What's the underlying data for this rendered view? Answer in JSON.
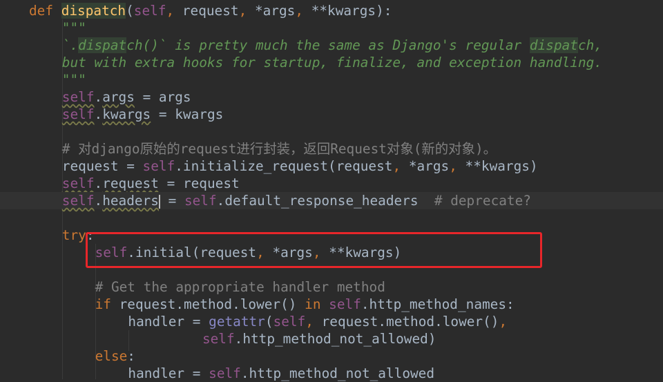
{
  "colors": {
    "background": "#2b2b2b",
    "keyword": "#cc7832",
    "function": "#ffc66d",
    "self": "#94558d",
    "docstring": "#629755",
    "comment": "#808080",
    "text": "#a9b7c6",
    "annotation_box": "#e8262a"
  },
  "lines": [
    {
      "indent": 0,
      "tokens": [
        {
          "t": "def ",
          "c": "kw"
        },
        {
          "t": "dispatch",
          "c": "fn hl"
        },
        {
          "t": "(",
          "c": "op"
        },
        {
          "t": "self",
          "c": "self"
        },
        {
          "t": ", ",
          "c": "punct"
        },
        {
          "t": "request",
          "c": "param"
        },
        {
          "t": ", ",
          "c": "punct"
        },
        {
          "t": "*args",
          "c": "param"
        },
        {
          "t": ", ",
          "c": "punct"
        },
        {
          "t": "**kwargs",
          "c": "param"
        },
        {
          "t": "):",
          "c": "op"
        }
      ]
    },
    {
      "indent": 4,
      "tokens": [
        {
          "t": "\"\"\"",
          "c": "doc"
        }
      ]
    },
    {
      "indent": 4,
      "tokens": [
        {
          "t": "`.",
          "c": "doc"
        },
        {
          "t": "dispat",
          "c": "doc hl"
        },
        {
          "t": "ch()` is pretty much the same as Django's regular ",
          "c": "doc"
        },
        {
          "t": "dispat",
          "c": "doc hl"
        },
        {
          "t": "ch,",
          "c": "doc"
        }
      ]
    },
    {
      "indent": 4,
      "tokens": [
        {
          "t": "but with extra hooks for startup, finalize, and exception handling.",
          "c": "doc"
        }
      ]
    },
    {
      "indent": 4,
      "tokens": [
        {
          "t": "\"\"\"",
          "c": "doc"
        }
      ]
    },
    {
      "indent": 4,
      "tokens": [
        {
          "t": "self",
          "c": "self wavy"
        },
        {
          "t": ".",
          "c": "op"
        },
        {
          "t": "args",
          "c": "op wavy"
        },
        {
          "t": " = args",
          "c": "op"
        }
      ]
    },
    {
      "indent": 4,
      "tokens": [
        {
          "t": "self",
          "c": "self wavy"
        },
        {
          "t": ".",
          "c": "op"
        },
        {
          "t": "kwargs",
          "c": "op wavy"
        },
        {
          "t": " = kwargs",
          "c": "op"
        }
      ]
    },
    {
      "indent": 4,
      "tokens": []
    },
    {
      "indent": 4,
      "tokens": [
        {
          "t": "# 对django原始的request进行封装，返回Request对象(新的对象)。",
          "c": "comment"
        }
      ]
    },
    {
      "indent": 4,
      "tokens": [
        {
          "t": "request = ",
          "c": "op"
        },
        {
          "t": "self",
          "c": "self"
        },
        {
          "t": ".initialize_request(request",
          "c": "op"
        },
        {
          "t": ", ",
          "c": "punct"
        },
        {
          "t": "*args",
          "c": "op"
        },
        {
          "t": ", ",
          "c": "punct"
        },
        {
          "t": "**kwargs)",
          "c": "op"
        }
      ]
    },
    {
      "indent": 4,
      "tokens": [
        {
          "t": "self",
          "c": "self wavy"
        },
        {
          "t": ".",
          "c": "op"
        },
        {
          "t": "request",
          "c": "op wavy"
        },
        {
          "t": " = request",
          "c": "op"
        }
      ]
    },
    {
      "indent": 4,
      "current": true,
      "tokens": [
        {
          "t": "self",
          "c": "self wavy"
        },
        {
          "t": ".",
          "c": "op"
        },
        {
          "t": "headers",
          "c": "op wavy"
        },
        {
          "t": "|",
          "c": "caret"
        },
        {
          "t": " = ",
          "c": "op"
        },
        {
          "t": "self",
          "c": "self"
        },
        {
          "t": ".default_response_headers  ",
          "c": "op"
        },
        {
          "t": "# deprecate?",
          "c": "comment"
        }
      ]
    },
    {
      "indent": 4,
      "tokens": []
    },
    {
      "indent": 4,
      "tokens": [
        {
          "t": "try",
          "c": "kw"
        },
        {
          "t": ":",
          "c": "op"
        }
      ]
    },
    {
      "indent": 8,
      "tokens": [
        {
          "t": "self",
          "c": "self"
        },
        {
          "t": ".initial(request",
          "c": "op"
        },
        {
          "t": ", ",
          "c": "punct"
        },
        {
          "t": "*args",
          "c": "op"
        },
        {
          "t": ", ",
          "c": "punct"
        },
        {
          "t": "**kwargs)",
          "c": "op"
        }
      ]
    },
    {
      "indent": 8,
      "tokens": []
    },
    {
      "indent": 8,
      "tokens": [
        {
          "t": "# Get the appropriate handler method",
          "c": "comment"
        }
      ]
    },
    {
      "indent": 8,
      "tokens": [
        {
          "t": "if ",
          "c": "kw"
        },
        {
          "t": "request.method.lower() ",
          "c": "op"
        },
        {
          "t": "in ",
          "c": "kw"
        },
        {
          "t": "self",
          "c": "self"
        },
        {
          "t": ".http_method_names:",
          "c": "op"
        }
      ]
    },
    {
      "indent": 12,
      "tokens": [
        {
          "t": "handler = ",
          "c": "op"
        },
        {
          "t": "getattr",
          "c": "builtin"
        },
        {
          "t": "(",
          "c": "op"
        },
        {
          "t": "self",
          "c": "self"
        },
        {
          "t": ", ",
          "c": "punct"
        },
        {
          "t": "request.method.lower()",
          "c": "op"
        },
        {
          "t": ",",
          "c": "punct"
        }
      ]
    },
    {
      "indent": 21,
      "tokens": [
        {
          "t": "self",
          "c": "self"
        },
        {
          "t": ".http_method_not_allowed)",
          "c": "op"
        }
      ]
    },
    {
      "indent": 8,
      "tokens": [
        {
          "t": "else",
          "c": "kw"
        },
        {
          "t": ":",
          "c": "op"
        }
      ]
    },
    {
      "indent": 12,
      "tokens": [
        {
          "t": "handler = ",
          "c": "op"
        },
        {
          "t": "self",
          "c": "self"
        },
        {
          "t": ".http_method_not_allowed",
          "c": "op"
        }
      ]
    }
  ]
}
